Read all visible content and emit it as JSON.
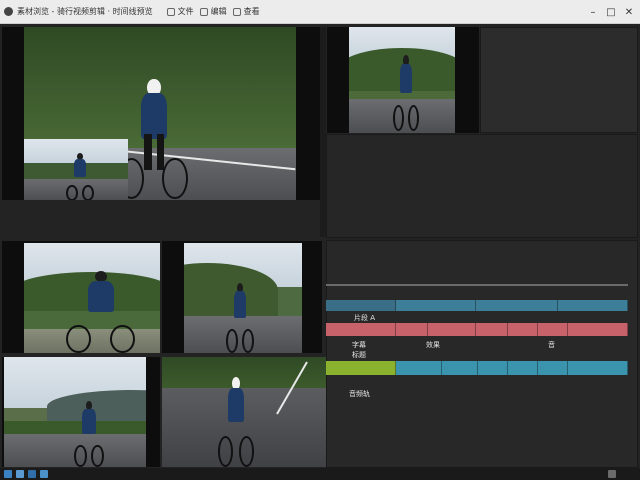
{
  "window": {
    "title": "素材浏览 - 骑行视频剪辑 · 时间线预览"
  },
  "toolbar": {
    "items": [
      "文件",
      "编辑",
      "查看"
    ]
  },
  "win_controls": {
    "minimize": "–",
    "maximize": "□",
    "close": "✕"
  },
  "timeline": {
    "labels": {
      "track1": "片段 A",
      "track2_a": "字幕",
      "track2_b": "效果",
      "track2_c": "音",
      "track2_d": "标题",
      "track3": "音频轨"
    }
  },
  "colors": {
    "track_blue": "#3d7f98",
    "track_red": "#c7626b",
    "track_teal": "#3b94ad",
    "track_green": "#8bb22f"
  }
}
